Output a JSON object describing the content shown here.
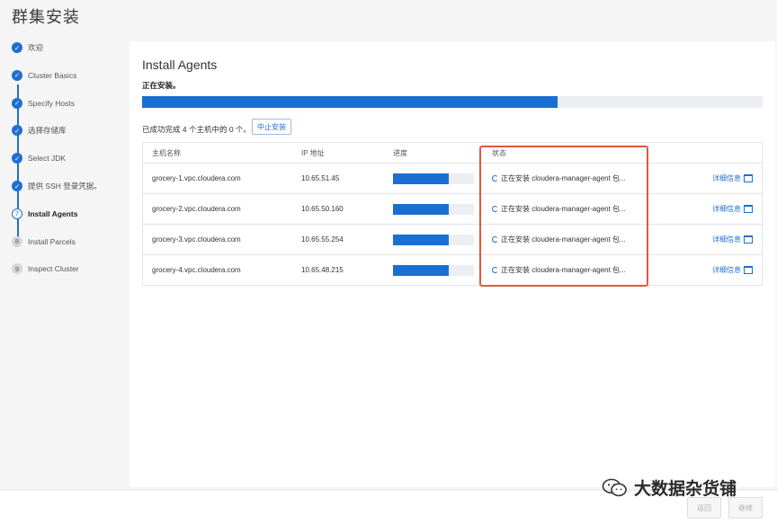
{
  "window": {
    "title": "群集安装"
  },
  "steps": [
    {
      "label": "欢迎",
      "marker": "check",
      "state": "done"
    },
    {
      "label": "Cluster Basics",
      "marker": "check",
      "state": "done"
    },
    {
      "label": "Specify Hosts",
      "marker": "check",
      "state": "done"
    },
    {
      "label": "选择存储库",
      "marker": "check",
      "state": "done"
    },
    {
      "label": "Select JDK",
      "marker": "check",
      "state": "done"
    },
    {
      "label": "提供 SSH 登录凭据。",
      "marker": "check",
      "state": "done"
    },
    {
      "label": "Install Agents",
      "marker": "7",
      "state": "current"
    },
    {
      "label": "Install Parcels",
      "marker": "8",
      "state": "todo"
    },
    {
      "label": "Inspect Cluster",
      "marker": "9",
      "state": "todo"
    }
  ],
  "main": {
    "heading": "Install Agents",
    "status_text": "正在安装。",
    "overall_progress": 0.67,
    "completed_text": "已成功完成 4 个主机中的 0 个。",
    "abort_label": "中止安装"
  },
  "table": {
    "headers": [
      "主机名称",
      "IP 地址",
      "进度",
      "状态",
      ""
    ],
    "rows": [
      {
        "host": "grocery-1.vpc.cloudera.com",
        "ip": "10.65.51.45",
        "progress": 0.69,
        "status": "正在安装 cloudera-manager-agent 包...",
        "details": "详细信息"
      },
      {
        "host": "grocery-2.vpc.cloudera.com",
        "ip": "10.65.50.160",
        "progress": 0.69,
        "status": "正在安装 cloudera-manager-agent 包...",
        "details": "详细信息"
      },
      {
        "host": "grocery-3.vpc.cloudera.com",
        "ip": "10.65.55.254",
        "progress": 0.69,
        "status": "正在安装 cloudera-manager-agent 包...",
        "details": "详细信息"
      },
      {
        "host": "grocery-4.vpc.cloudera.com",
        "ip": "10.65.48.215",
        "progress": 0.69,
        "status": "正在安装 cloudera-manager-agent 包...",
        "details": "详细信息"
      }
    ]
  },
  "footer": {
    "back_label": "返回",
    "continue_label": "继续"
  },
  "watermark": {
    "text": "大数据杂货铺"
  },
  "colors": {
    "accent": "#1a6fd1",
    "highlight": "#e2583a"
  }
}
